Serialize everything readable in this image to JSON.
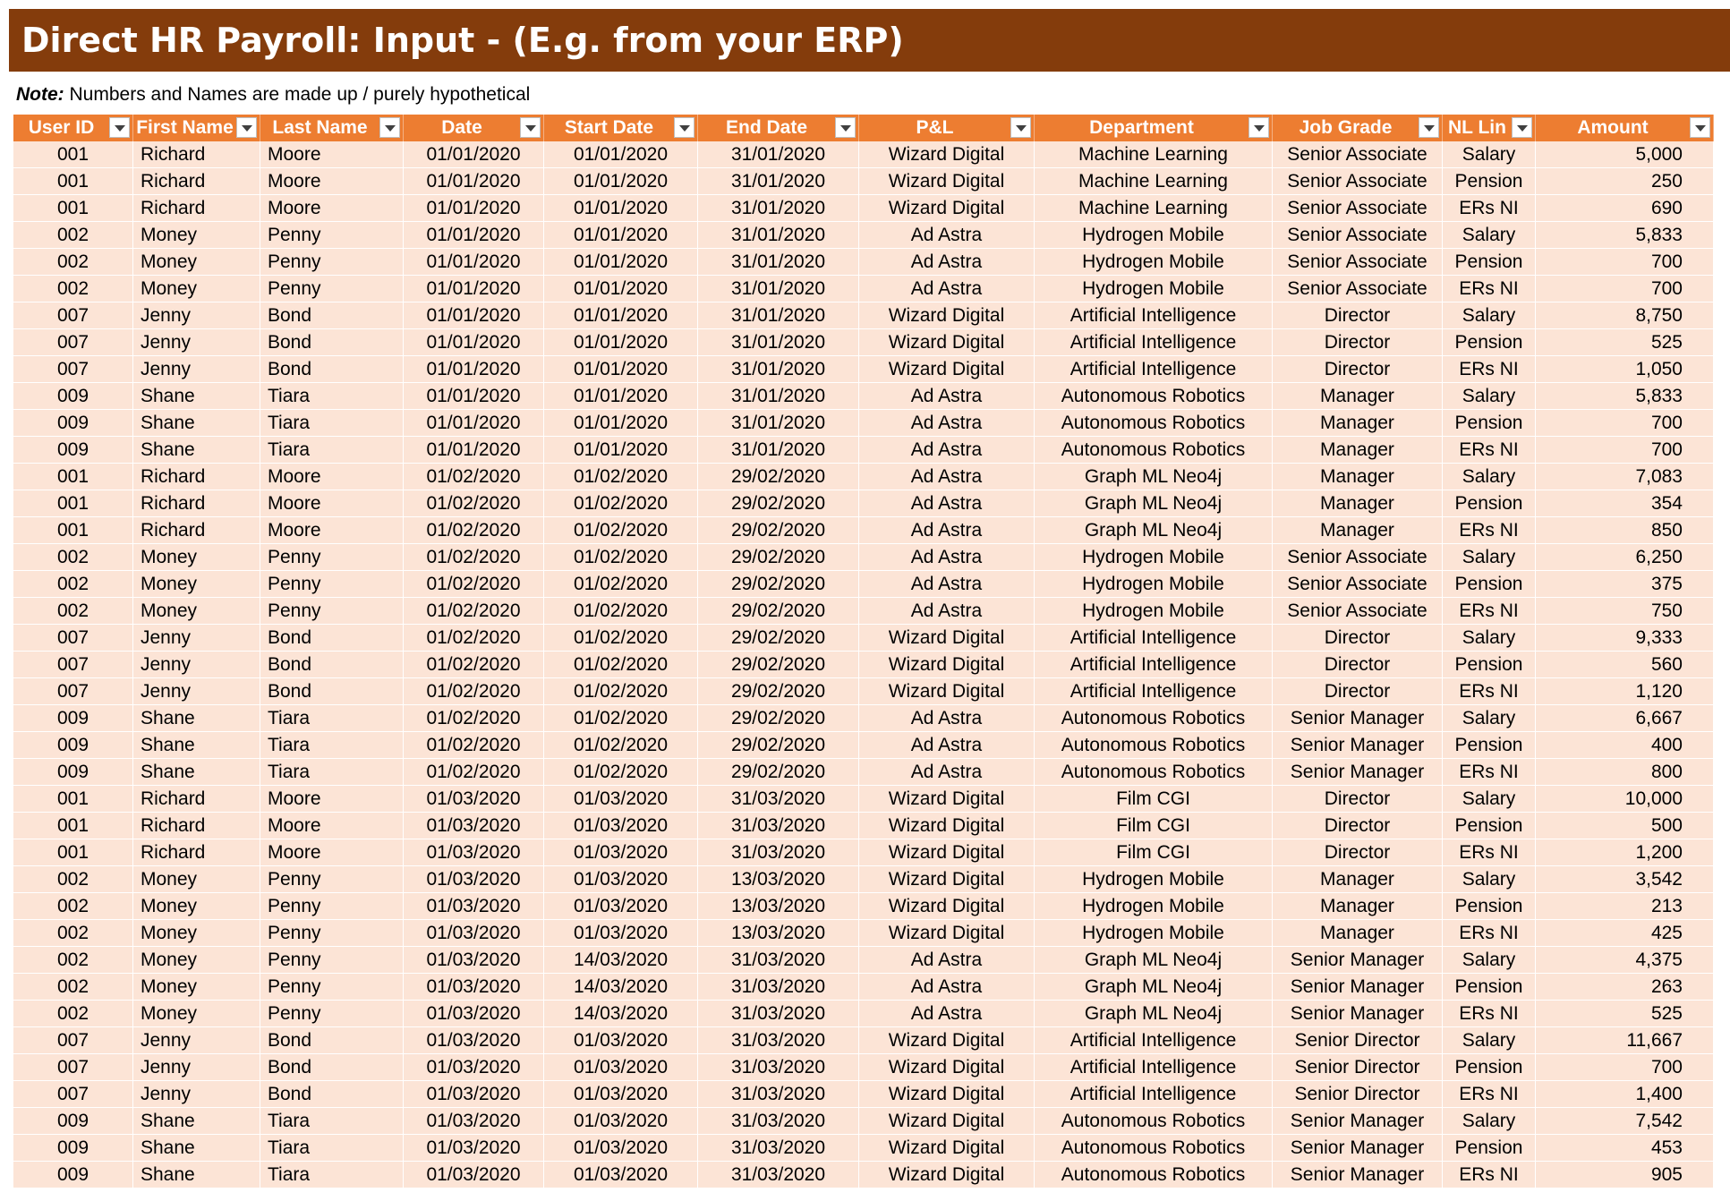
{
  "title": "Direct HR Payroll: Input - (E.g. from your ERP)",
  "note_label": "Note:",
  "note_text": "Numbers and Names are made up / purely hypothetical",
  "colors": {
    "banner": "#843c0c",
    "header": "#ed7d31",
    "row": "#fce4d6"
  },
  "columns": [
    "User ID",
    "First Name",
    "Last Name",
    "Date",
    "Start Date",
    "End Date",
    "P&L",
    "Department",
    "Job Grade",
    "NL Lin",
    "Amount"
  ],
  "rows": [
    [
      "001",
      "Richard",
      "Moore",
      "01/01/2020",
      "01/01/2020",
      "31/01/2020",
      "Wizard Digital",
      "Machine Learning",
      "Senior Associate",
      "Salary",
      "5,000"
    ],
    [
      "001",
      "Richard",
      "Moore",
      "01/01/2020",
      "01/01/2020",
      "31/01/2020",
      "Wizard Digital",
      "Machine Learning",
      "Senior Associate",
      "Pension",
      "250"
    ],
    [
      "001",
      "Richard",
      "Moore",
      "01/01/2020",
      "01/01/2020",
      "31/01/2020",
      "Wizard Digital",
      "Machine Learning",
      "Senior Associate",
      "ERs NI",
      "690"
    ],
    [
      "002",
      "Money",
      "Penny",
      "01/01/2020",
      "01/01/2020",
      "31/01/2020",
      "Ad Astra",
      "Hydrogen Mobile",
      "Senior Associate",
      "Salary",
      "5,833"
    ],
    [
      "002",
      "Money",
      "Penny",
      "01/01/2020",
      "01/01/2020",
      "31/01/2020",
      "Ad Astra",
      "Hydrogen Mobile",
      "Senior Associate",
      "Pension",
      "700"
    ],
    [
      "002",
      "Money",
      "Penny",
      "01/01/2020",
      "01/01/2020",
      "31/01/2020",
      "Ad Astra",
      "Hydrogen Mobile",
      "Senior Associate",
      "ERs NI",
      "700"
    ],
    [
      "007",
      "Jenny",
      "Bond",
      "01/01/2020",
      "01/01/2020",
      "31/01/2020",
      "Wizard Digital",
      "Artificial Intelligence",
      "Director",
      "Salary",
      "8,750"
    ],
    [
      "007",
      "Jenny",
      "Bond",
      "01/01/2020",
      "01/01/2020",
      "31/01/2020",
      "Wizard Digital",
      "Artificial Intelligence",
      "Director",
      "Pension",
      "525"
    ],
    [
      "007",
      "Jenny",
      "Bond",
      "01/01/2020",
      "01/01/2020",
      "31/01/2020",
      "Wizard Digital",
      "Artificial Intelligence",
      "Director",
      "ERs NI",
      "1,050"
    ],
    [
      "009",
      "Shane",
      "Tiara",
      "01/01/2020",
      "01/01/2020",
      "31/01/2020",
      "Ad Astra",
      "Autonomous Robotics",
      "Manager",
      "Salary",
      "5,833"
    ],
    [
      "009",
      "Shane",
      "Tiara",
      "01/01/2020",
      "01/01/2020",
      "31/01/2020",
      "Ad Astra",
      "Autonomous Robotics",
      "Manager",
      "Pension",
      "700"
    ],
    [
      "009",
      "Shane",
      "Tiara",
      "01/01/2020",
      "01/01/2020",
      "31/01/2020",
      "Ad Astra",
      "Autonomous Robotics",
      "Manager",
      "ERs NI",
      "700"
    ],
    [
      "001",
      "Richard",
      "Moore",
      "01/02/2020",
      "01/02/2020",
      "29/02/2020",
      "Ad Astra",
      "Graph ML Neo4j",
      "Manager",
      "Salary",
      "7,083"
    ],
    [
      "001",
      "Richard",
      "Moore",
      "01/02/2020",
      "01/02/2020",
      "29/02/2020",
      "Ad Astra",
      "Graph ML Neo4j",
      "Manager",
      "Pension",
      "354"
    ],
    [
      "001",
      "Richard",
      "Moore",
      "01/02/2020",
      "01/02/2020",
      "29/02/2020",
      "Ad Astra",
      "Graph ML Neo4j",
      "Manager",
      "ERs NI",
      "850"
    ],
    [
      "002",
      "Money",
      "Penny",
      "01/02/2020",
      "01/02/2020",
      "29/02/2020",
      "Ad Astra",
      "Hydrogen Mobile",
      "Senior Associate",
      "Salary",
      "6,250"
    ],
    [
      "002",
      "Money",
      "Penny",
      "01/02/2020",
      "01/02/2020",
      "29/02/2020",
      "Ad Astra",
      "Hydrogen Mobile",
      "Senior Associate",
      "Pension",
      "375"
    ],
    [
      "002",
      "Money",
      "Penny",
      "01/02/2020",
      "01/02/2020",
      "29/02/2020",
      "Ad Astra",
      "Hydrogen Mobile",
      "Senior Associate",
      "ERs NI",
      "750"
    ],
    [
      "007",
      "Jenny",
      "Bond",
      "01/02/2020",
      "01/02/2020",
      "29/02/2020",
      "Wizard Digital",
      "Artificial Intelligence",
      "Director",
      "Salary",
      "9,333"
    ],
    [
      "007",
      "Jenny",
      "Bond",
      "01/02/2020",
      "01/02/2020",
      "29/02/2020",
      "Wizard Digital",
      "Artificial Intelligence",
      "Director",
      "Pension",
      "560"
    ],
    [
      "007",
      "Jenny",
      "Bond",
      "01/02/2020",
      "01/02/2020",
      "29/02/2020",
      "Wizard Digital",
      "Artificial Intelligence",
      "Director",
      "ERs NI",
      "1,120"
    ],
    [
      "009",
      "Shane",
      "Tiara",
      "01/02/2020",
      "01/02/2020",
      "29/02/2020",
      "Ad Astra",
      "Autonomous Robotics",
      "Senior Manager",
      "Salary",
      "6,667"
    ],
    [
      "009",
      "Shane",
      "Tiara",
      "01/02/2020",
      "01/02/2020",
      "29/02/2020",
      "Ad Astra",
      "Autonomous Robotics",
      "Senior Manager",
      "Pension",
      "400"
    ],
    [
      "009",
      "Shane",
      "Tiara",
      "01/02/2020",
      "01/02/2020",
      "29/02/2020",
      "Ad Astra",
      "Autonomous Robotics",
      "Senior Manager",
      "ERs NI",
      "800"
    ],
    [
      "001",
      "Richard",
      "Moore",
      "01/03/2020",
      "01/03/2020",
      "31/03/2020",
      "Wizard Digital",
      "Film CGI",
      "Director",
      "Salary",
      "10,000"
    ],
    [
      "001",
      "Richard",
      "Moore",
      "01/03/2020",
      "01/03/2020",
      "31/03/2020",
      "Wizard Digital",
      "Film CGI",
      "Director",
      "Pension",
      "500"
    ],
    [
      "001",
      "Richard",
      "Moore",
      "01/03/2020",
      "01/03/2020",
      "31/03/2020",
      "Wizard Digital",
      "Film CGI",
      "Director",
      "ERs NI",
      "1,200"
    ],
    [
      "002",
      "Money",
      "Penny",
      "01/03/2020",
      "01/03/2020",
      "13/03/2020",
      "Wizard Digital",
      "Hydrogen Mobile",
      "Manager",
      "Salary",
      "3,542"
    ],
    [
      "002",
      "Money",
      "Penny",
      "01/03/2020",
      "01/03/2020",
      "13/03/2020",
      "Wizard Digital",
      "Hydrogen Mobile",
      "Manager",
      "Pension",
      "213"
    ],
    [
      "002",
      "Money",
      "Penny",
      "01/03/2020",
      "01/03/2020",
      "13/03/2020",
      "Wizard Digital",
      "Hydrogen Mobile",
      "Manager",
      "ERs NI",
      "425"
    ],
    [
      "002",
      "Money",
      "Penny",
      "01/03/2020",
      "14/03/2020",
      "31/03/2020",
      "Ad Astra",
      "Graph ML Neo4j",
      "Senior Manager",
      "Salary",
      "4,375"
    ],
    [
      "002",
      "Money",
      "Penny",
      "01/03/2020",
      "14/03/2020",
      "31/03/2020",
      "Ad Astra",
      "Graph ML Neo4j",
      "Senior Manager",
      "Pension",
      "263"
    ],
    [
      "002",
      "Money",
      "Penny",
      "01/03/2020",
      "14/03/2020",
      "31/03/2020",
      "Ad Astra",
      "Graph ML Neo4j",
      "Senior Manager",
      "ERs NI",
      "525"
    ],
    [
      "007",
      "Jenny",
      "Bond",
      "01/03/2020",
      "01/03/2020",
      "31/03/2020",
      "Wizard Digital",
      "Artificial Intelligence",
      "Senior Director",
      "Salary",
      "11,667"
    ],
    [
      "007",
      "Jenny",
      "Bond",
      "01/03/2020",
      "01/03/2020",
      "31/03/2020",
      "Wizard Digital",
      "Artificial Intelligence",
      "Senior Director",
      "Pension",
      "700"
    ],
    [
      "007",
      "Jenny",
      "Bond",
      "01/03/2020",
      "01/03/2020",
      "31/03/2020",
      "Wizard Digital",
      "Artificial Intelligence",
      "Senior Director",
      "ERs NI",
      "1,400"
    ],
    [
      "009",
      "Shane",
      "Tiara",
      "01/03/2020",
      "01/03/2020",
      "31/03/2020",
      "Wizard Digital",
      "Autonomous Robotics",
      "Senior Manager",
      "Salary",
      "7,542"
    ],
    [
      "009",
      "Shane",
      "Tiara",
      "01/03/2020",
      "01/03/2020",
      "31/03/2020",
      "Wizard Digital",
      "Autonomous Robotics",
      "Senior Manager",
      "Pension",
      "453"
    ],
    [
      "009",
      "Shane",
      "Tiara",
      "01/03/2020",
      "01/03/2020",
      "31/03/2020",
      "Wizard Digital",
      "Autonomous Robotics",
      "Senior Manager",
      "ERs NI",
      "905"
    ]
  ]
}
